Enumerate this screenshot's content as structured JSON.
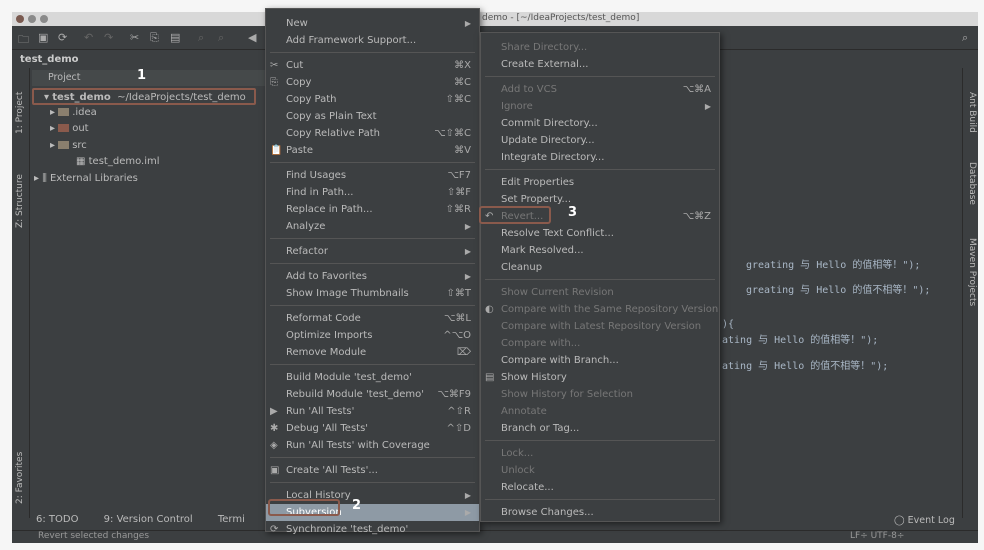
{
  "window": {
    "title": "demo - [~/IdeaProjects/test_demo]"
  },
  "breadcrumb": "test_demo",
  "left_tabs": {
    "project": "1: Project",
    "structure": "Z: Structure",
    "favorites": "2: Favorites"
  },
  "right_tabs": {
    "ant": "Ant Build",
    "database": "Database",
    "maven": "Maven Projects"
  },
  "project_panel": {
    "header": "Project",
    "tree": [
      {
        "label": "test_demo",
        "path": "~/IdeaProjects/test_demo"
      },
      {
        "label": ".idea"
      },
      {
        "label": "out"
      },
      {
        "label": "src"
      },
      {
        "label": "test_demo.iml"
      },
      {
        "label": "External Libraries"
      }
    ]
  },
  "annotations": {
    "one": "1",
    "two": "2",
    "three": "3"
  },
  "editor_lines": [
    "greating 与 Hello 的值相等！\");",
    "greating 与 Hello 的值不相等！\");",
    "){",
    "ating 与 Hello 的值相等！\");",
    "ating 与 Hello 的值不相等！\");"
  ],
  "bottom_tabs": [
    "6: TODO",
    "9: Version Control",
    "Termi"
  ],
  "event_log": "Event Log",
  "status": {
    "message": "Revert selected changes",
    "encoding": "LF÷ UTF-8÷"
  },
  "context_menu": [
    {
      "label": "New",
      "arrow": true
    },
    {
      "label": "Add Framework Support..."
    },
    {
      "sep": true
    },
    {
      "label": "Cut",
      "sc": "⌘X",
      "icon": "✂"
    },
    {
      "label": "Copy",
      "sc": "⌘C",
      "icon": "⎘"
    },
    {
      "label": "Copy Path",
      "sc": "⇧⌘C"
    },
    {
      "label": "Copy as Plain Text"
    },
    {
      "label": "Copy Relative Path",
      "sc": "⌥⇧⌘C"
    },
    {
      "label": "Paste",
      "sc": "⌘V",
      "icon": "📋"
    },
    {
      "sep": true
    },
    {
      "label": "Find Usages",
      "sc": "⌥F7"
    },
    {
      "label": "Find in Path...",
      "sc": "⇧⌘F"
    },
    {
      "label": "Replace in Path...",
      "sc": "⇧⌘R"
    },
    {
      "label": "Analyze",
      "arrow": true
    },
    {
      "sep": true
    },
    {
      "label": "Refactor",
      "arrow": true
    },
    {
      "sep": true
    },
    {
      "label": "Add to Favorites",
      "arrow": true
    },
    {
      "label": "Show Image Thumbnails",
      "sc": "⇧⌘T"
    },
    {
      "sep": true
    },
    {
      "label": "Reformat Code",
      "sc": "⌥⌘L"
    },
    {
      "label": "Optimize Imports",
      "sc": "^⌥O"
    },
    {
      "label": "Remove Module",
      "sc": "⌦"
    },
    {
      "sep": true
    },
    {
      "label": "Build Module 'test_demo'"
    },
    {
      "label": "Rebuild Module 'test_demo'",
      "sc": "⌥⌘F9"
    },
    {
      "label": "Run 'All Tests'",
      "sc": "^⇧R",
      "icon": "▶"
    },
    {
      "label": "Debug 'All Tests'",
      "sc": "^⇧D",
      "icon": "✱"
    },
    {
      "label": "Run 'All Tests' with Coverage",
      "icon": "◈"
    },
    {
      "sep": true
    },
    {
      "label": "Create 'All Tests'...",
      "icon": "▣"
    },
    {
      "sep": true
    },
    {
      "label": "Local History",
      "arrow": true
    },
    {
      "label": "Subversion",
      "highlight": true,
      "arrow": true
    },
    {
      "label": "Synchronize 'test_demo'",
      "icon": "⟳"
    }
  ],
  "subversion_menu": [
    {
      "label": "Share Directory...",
      "disabled": true
    },
    {
      "label": "Create External..."
    },
    {
      "sep": true
    },
    {
      "label": "Add to VCS",
      "sc": "⌥⌘A",
      "disabled": true
    },
    {
      "label": "Ignore",
      "arrow": true,
      "disabled": true
    },
    {
      "label": "Commit Directory..."
    },
    {
      "label": "Update Directory..."
    },
    {
      "label": "Integrate Directory..."
    },
    {
      "sep": true
    },
    {
      "label": "Edit Properties"
    },
    {
      "label": "Set Property..."
    },
    {
      "label": "Revert...",
      "sc": "⌥⌘Z",
      "disabled": true,
      "icon": "↶"
    },
    {
      "label": "Resolve Text Conflict..."
    },
    {
      "label": "Mark Resolved..."
    },
    {
      "label": "Cleanup"
    },
    {
      "sep": true
    },
    {
      "label": "Show Current Revision",
      "disabled": true
    },
    {
      "label": "Compare with the Same Repository Version",
      "disabled": true,
      "icon": "◐"
    },
    {
      "label": "Compare with Latest Repository Version",
      "disabled": true
    },
    {
      "label": "Compare with...",
      "disabled": true
    },
    {
      "label": "Compare with Branch..."
    },
    {
      "label": "Show History",
      "icon": "▤"
    },
    {
      "label": "Show History for Selection",
      "disabled": true
    },
    {
      "label": "Annotate",
      "disabled": true
    },
    {
      "label": "Branch or Tag..."
    },
    {
      "sep": true
    },
    {
      "label": "Lock...",
      "disabled": true
    },
    {
      "label": "Unlock",
      "disabled": true
    },
    {
      "label": "Relocate..."
    },
    {
      "sep": true
    },
    {
      "label": "Browse Changes..."
    }
  ]
}
